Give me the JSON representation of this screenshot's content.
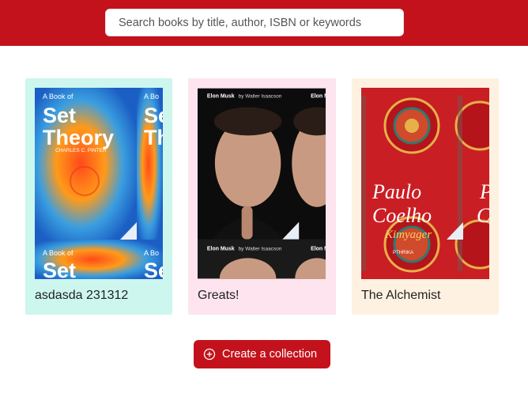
{
  "header": {
    "background_color": "#c4121c",
    "search": {
      "placeholder": "Search books by title, author, ISBN or keywords",
      "value": ""
    }
  },
  "collections": [
    {
      "title": "asdasda 231312",
      "background_color": "#cdf6ef",
      "cover": {
        "title_line1": "Set",
        "title_line2": "Theory",
        "prefix": "A Book of",
        "author": "CHARLES C. PINTER"
      }
    },
    {
      "title": "Greats!",
      "background_color": "#fde4ef",
      "cover": {
        "header": "Elon Musk",
        "by": "by Walter Isaacson"
      }
    },
    {
      "title": "The Alchemist",
      "background_color": "#fff1e1",
      "cover": {
        "author": "Paulo Coelho",
        "title": "Kimyager",
        "publisher": "PTHRIKA"
      }
    }
  ],
  "actions": {
    "create_collection_label": "Create a collection",
    "icon": "plus-circle-icon"
  }
}
